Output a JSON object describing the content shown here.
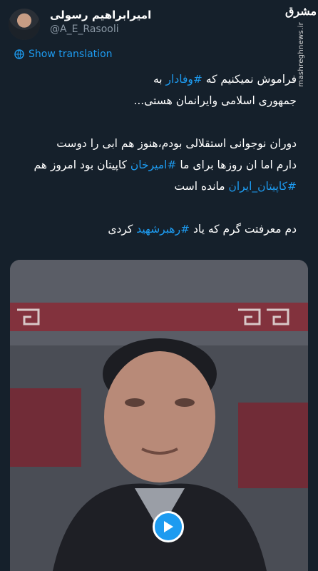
{
  "author": {
    "display_name": "امیرابراهیم رسولی",
    "handle": "@A_E_Rasooli"
  },
  "brand": {
    "logo_text": "مشرق",
    "url": "mashreghnews.ir"
  },
  "translate": {
    "label": "Show translation",
    "icon": "globe-icon"
  },
  "tweet": {
    "line1_pre": "فراموش نمیکنیم که ",
    "line1_tag": "#وفادار",
    "line1_post": " به",
    "line2": "جمهوری اسلامی وایرانمان هستی...",
    "line3": "دوران نوجوانی استقلالی بودم،هنوز هم ابی را دوست",
    "line4_pre": "دارم اما ان روزها برای ما ",
    "line4_tag": "#امیرخان",
    "line4_post": " کاپیتان بود امروز هم",
    "line5_tag": "#کاپیتان_ایران",
    "line5_post": " مانده است",
    "line6_pre": "دم معرفتت گرم که یاد ",
    "line6_tag": "#رهبرشهید",
    "line6_post": " کردی"
  },
  "media": {
    "type": "video",
    "play_icon": "play-icon"
  },
  "colors": {
    "background": "#15202b",
    "accent": "#1d9bf0",
    "muted": "#8b98a5"
  }
}
